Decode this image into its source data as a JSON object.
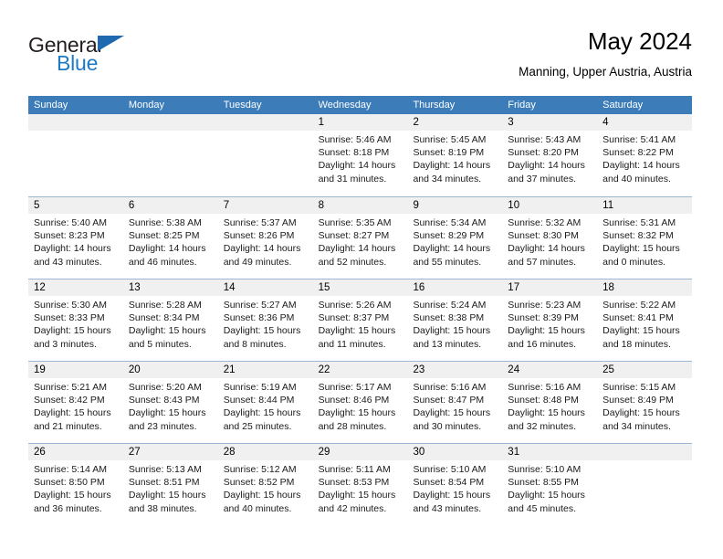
{
  "brand": {
    "name_part1": "General",
    "name_part2": "Blue",
    "color_dark": "#231f20",
    "color_blue": "#1f7ac4"
  },
  "header": {
    "title": "May 2024",
    "subtitle": "Manning, Upper Austria, Austria"
  },
  "theme": {
    "header_row_bg": "#3b7cb9",
    "day_num_bg": "#f0f0f0",
    "row_border": "#9bb7d4"
  },
  "weekdays": [
    "Sunday",
    "Monday",
    "Tuesday",
    "Wednesday",
    "Thursday",
    "Friday",
    "Saturday"
  ],
  "weeks": [
    [
      {
        "day": "",
        "sunrise": "",
        "sunset": "",
        "daylight1": "",
        "daylight2": ""
      },
      {
        "day": "",
        "sunrise": "",
        "sunset": "",
        "daylight1": "",
        "daylight2": ""
      },
      {
        "day": "",
        "sunrise": "",
        "sunset": "",
        "daylight1": "",
        "daylight2": ""
      },
      {
        "day": "1",
        "sunrise": "Sunrise: 5:46 AM",
        "sunset": "Sunset: 8:18 PM",
        "daylight1": "Daylight: 14 hours",
        "daylight2": "and 31 minutes."
      },
      {
        "day": "2",
        "sunrise": "Sunrise: 5:45 AM",
        "sunset": "Sunset: 8:19 PM",
        "daylight1": "Daylight: 14 hours",
        "daylight2": "and 34 minutes."
      },
      {
        "day": "3",
        "sunrise": "Sunrise: 5:43 AM",
        "sunset": "Sunset: 8:20 PM",
        "daylight1": "Daylight: 14 hours",
        "daylight2": "and 37 minutes."
      },
      {
        "day": "4",
        "sunrise": "Sunrise: 5:41 AM",
        "sunset": "Sunset: 8:22 PM",
        "daylight1": "Daylight: 14 hours",
        "daylight2": "and 40 minutes."
      }
    ],
    [
      {
        "day": "5",
        "sunrise": "Sunrise: 5:40 AM",
        "sunset": "Sunset: 8:23 PM",
        "daylight1": "Daylight: 14 hours",
        "daylight2": "and 43 minutes."
      },
      {
        "day": "6",
        "sunrise": "Sunrise: 5:38 AM",
        "sunset": "Sunset: 8:25 PM",
        "daylight1": "Daylight: 14 hours",
        "daylight2": "and 46 minutes."
      },
      {
        "day": "7",
        "sunrise": "Sunrise: 5:37 AM",
        "sunset": "Sunset: 8:26 PM",
        "daylight1": "Daylight: 14 hours",
        "daylight2": "and 49 minutes."
      },
      {
        "day": "8",
        "sunrise": "Sunrise: 5:35 AM",
        "sunset": "Sunset: 8:27 PM",
        "daylight1": "Daylight: 14 hours",
        "daylight2": "and 52 minutes."
      },
      {
        "day": "9",
        "sunrise": "Sunrise: 5:34 AM",
        "sunset": "Sunset: 8:29 PM",
        "daylight1": "Daylight: 14 hours",
        "daylight2": "and 55 minutes."
      },
      {
        "day": "10",
        "sunrise": "Sunrise: 5:32 AM",
        "sunset": "Sunset: 8:30 PM",
        "daylight1": "Daylight: 14 hours",
        "daylight2": "and 57 minutes."
      },
      {
        "day": "11",
        "sunrise": "Sunrise: 5:31 AM",
        "sunset": "Sunset: 8:32 PM",
        "daylight1": "Daylight: 15 hours",
        "daylight2": "and 0 minutes."
      }
    ],
    [
      {
        "day": "12",
        "sunrise": "Sunrise: 5:30 AM",
        "sunset": "Sunset: 8:33 PM",
        "daylight1": "Daylight: 15 hours",
        "daylight2": "and 3 minutes."
      },
      {
        "day": "13",
        "sunrise": "Sunrise: 5:28 AM",
        "sunset": "Sunset: 8:34 PM",
        "daylight1": "Daylight: 15 hours",
        "daylight2": "and 5 minutes."
      },
      {
        "day": "14",
        "sunrise": "Sunrise: 5:27 AM",
        "sunset": "Sunset: 8:36 PM",
        "daylight1": "Daylight: 15 hours",
        "daylight2": "and 8 minutes."
      },
      {
        "day": "15",
        "sunrise": "Sunrise: 5:26 AM",
        "sunset": "Sunset: 8:37 PM",
        "daylight1": "Daylight: 15 hours",
        "daylight2": "and 11 minutes."
      },
      {
        "day": "16",
        "sunrise": "Sunrise: 5:24 AM",
        "sunset": "Sunset: 8:38 PM",
        "daylight1": "Daylight: 15 hours",
        "daylight2": "and 13 minutes."
      },
      {
        "day": "17",
        "sunrise": "Sunrise: 5:23 AM",
        "sunset": "Sunset: 8:39 PM",
        "daylight1": "Daylight: 15 hours",
        "daylight2": "and 16 minutes."
      },
      {
        "day": "18",
        "sunrise": "Sunrise: 5:22 AM",
        "sunset": "Sunset: 8:41 PM",
        "daylight1": "Daylight: 15 hours",
        "daylight2": "and 18 minutes."
      }
    ],
    [
      {
        "day": "19",
        "sunrise": "Sunrise: 5:21 AM",
        "sunset": "Sunset: 8:42 PM",
        "daylight1": "Daylight: 15 hours",
        "daylight2": "and 21 minutes."
      },
      {
        "day": "20",
        "sunrise": "Sunrise: 5:20 AM",
        "sunset": "Sunset: 8:43 PM",
        "daylight1": "Daylight: 15 hours",
        "daylight2": "and 23 minutes."
      },
      {
        "day": "21",
        "sunrise": "Sunrise: 5:19 AM",
        "sunset": "Sunset: 8:44 PM",
        "daylight1": "Daylight: 15 hours",
        "daylight2": "and 25 minutes."
      },
      {
        "day": "22",
        "sunrise": "Sunrise: 5:17 AM",
        "sunset": "Sunset: 8:46 PM",
        "daylight1": "Daylight: 15 hours",
        "daylight2": "and 28 minutes."
      },
      {
        "day": "23",
        "sunrise": "Sunrise: 5:16 AM",
        "sunset": "Sunset: 8:47 PM",
        "daylight1": "Daylight: 15 hours",
        "daylight2": "and 30 minutes."
      },
      {
        "day": "24",
        "sunrise": "Sunrise: 5:16 AM",
        "sunset": "Sunset: 8:48 PM",
        "daylight1": "Daylight: 15 hours",
        "daylight2": "and 32 minutes."
      },
      {
        "day": "25",
        "sunrise": "Sunrise: 5:15 AM",
        "sunset": "Sunset: 8:49 PM",
        "daylight1": "Daylight: 15 hours",
        "daylight2": "and 34 minutes."
      }
    ],
    [
      {
        "day": "26",
        "sunrise": "Sunrise: 5:14 AM",
        "sunset": "Sunset: 8:50 PM",
        "daylight1": "Daylight: 15 hours",
        "daylight2": "and 36 minutes."
      },
      {
        "day": "27",
        "sunrise": "Sunrise: 5:13 AM",
        "sunset": "Sunset: 8:51 PM",
        "daylight1": "Daylight: 15 hours",
        "daylight2": "and 38 minutes."
      },
      {
        "day": "28",
        "sunrise": "Sunrise: 5:12 AM",
        "sunset": "Sunset: 8:52 PM",
        "daylight1": "Daylight: 15 hours",
        "daylight2": "and 40 minutes."
      },
      {
        "day": "29",
        "sunrise": "Sunrise: 5:11 AM",
        "sunset": "Sunset: 8:53 PM",
        "daylight1": "Daylight: 15 hours",
        "daylight2": "and 42 minutes."
      },
      {
        "day": "30",
        "sunrise": "Sunrise: 5:10 AM",
        "sunset": "Sunset: 8:54 PM",
        "daylight1": "Daylight: 15 hours",
        "daylight2": "and 43 minutes."
      },
      {
        "day": "31",
        "sunrise": "Sunrise: 5:10 AM",
        "sunset": "Sunset: 8:55 PM",
        "daylight1": "Daylight: 15 hours",
        "daylight2": "and 45 minutes."
      },
      {
        "day": "",
        "sunrise": "",
        "sunset": "",
        "daylight1": "",
        "daylight2": ""
      }
    ]
  ]
}
